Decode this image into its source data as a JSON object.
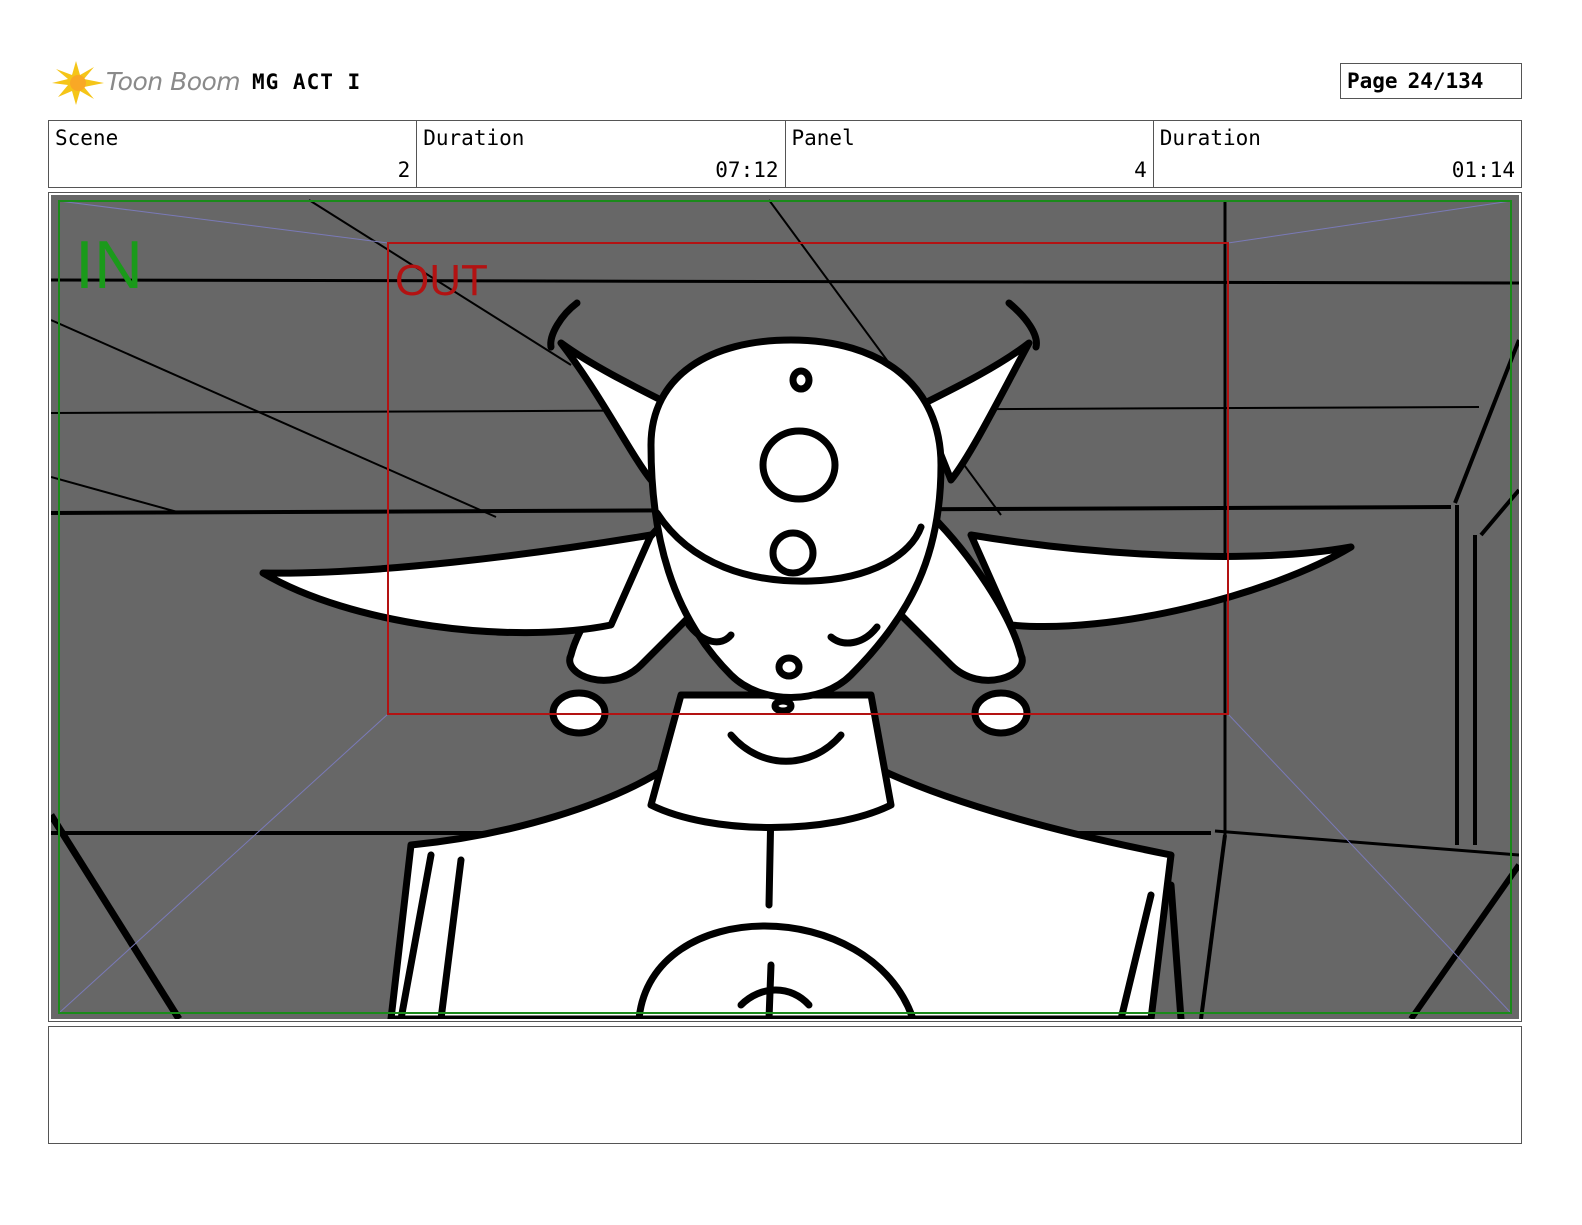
{
  "header": {
    "logo_text": "Toon Boom",
    "project_title": "MG ACT I",
    "page_label": "Page",
    "page_value": "24/134"
  },
  "info": {
    "scene_label": "Scene",
    "scene_value": "2",
    "scene_duration_label": "Duration",
    "scene_duration_value": "07:12",
    "panel_label": "Panel",
    "panel_value": "4",
    "panel_duration_label": "Duration",
    "panel_duration_value": "01:14"
  },
  "frame": {
    "in_label": "IN",
    "out_label": "OUT",
    "colors": {
      "background": "#676767",
      "in_frame": "#1a8a1a",
      "out_frame": "#b31212",
      "guide_lines": "#7a7ab8",
      "ink": "#000000"
    }
  },
  "notes": {
    "text": ""
  }
}
